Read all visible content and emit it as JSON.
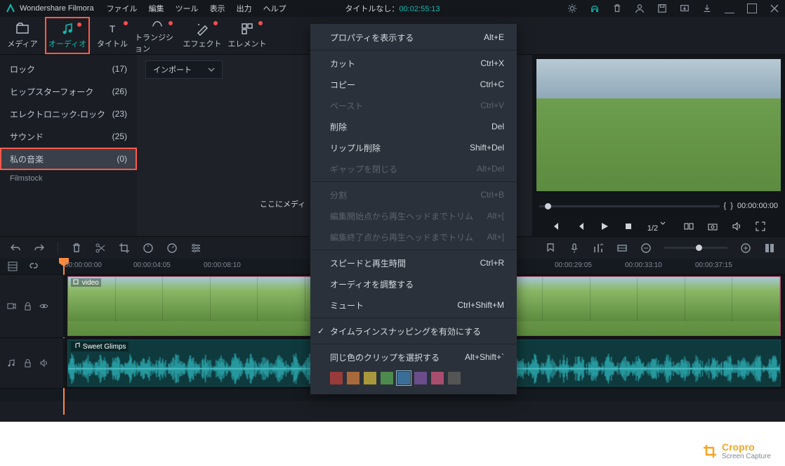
{
  "title_app": "Wondershare Filmora",
  "menus": [
    "ファイル",
    "編集",
    "ツール",
    "表示",
    "出力",
    "ヘルプ"
  ],
  "titlebar_center_pre": "タイトルなし：",
  "titlebar_center_tc": "00:02:55:13",
  "ribbon": [
    {
      "id": "media",
      "label": "メディア"
    },
    {
      "id": "audio",
      "label": "オーディオ"
    },
    {
      "id": "title",
      "label": "タイトル"
    },
    {
      "id": "transition",
      "label": "トランジション"
    },
    {
      "id": "effect",
      "label": "エフェクト"
    },
    {
      "id": "element",
      "label": "エレメント"
    }
  ],
  "side_rows": [
    {
      "label": "ロック",
      "count": "(17)"
    },
    {
      "label": "ヒップスターフォーク",
      "count": "(26)"
    },
    {
      "label": "エレクトロニック-ロック",
      "count": "(23)"
    },
    {
      "label": "サウンド",
      "count": "(25)"
    },
    {
      "label": "私の音楽",
      "count": "(0)"
    }
  ],
  "filmstock": "Filmstock",
  "import_label": "インポート",
  "drop_hint": "ここにメディ",
  "slider_marks": {
    "left": "{",
    "right": "}",
    "time": "00:00:00:00"
  },
  "playback_ratio": "1/2",
  "ruler_ticks": [
    "00:00:00:00",
    "00:00:04:05",
    "00:00:08:10",
    "00:00:29:05",
    "00:00:33:10",
    "00:00:37:15"
  ],
  "track_video_label": "video",
  "track_audio_label": "Sweet Glimps",
  "ctx": {
    "items": [
      {
        "label": "プロパティを表示する",
        "sc": "Alt+E"
      },
      {
        "sep": true
      },
      {
        "label": "カット",
        "sc": "Ctrl+X"
      },
      {
        "label": "コピー",
        "sc": "Ctrl+C"
      },
      {
        "label": "ペースト",
        "sc": "Ctrl+V",
        "dis": true
      },
      {
        "label": "削除",
        "sc": "Del"
      },
      {
        "label": "リップル削除",
        "sc": "Shift+Del"
      },
      {
        "label": "ギャップを閉じる",
        "sc": "Alt+Del",
        "dis": true
      },
      {
        "sep": true
      },
      {
        "label": "分割",
        "sc": "Ctrl+B",
        "dis": true
      },
      {
        "label": "編集開始点から再生ヘッドまでトリム",
        "sc": "Alt+[",
        "dis": true
      },
      {
        "label": "編集終了点から再生ヘッドまでトリム",
        "sc": "Alt+]",
        "dis": true
      },
      {
        "sep": true
      },
      {
        "label": "スピードと再生時間",
        "sc": "Ctrl+R"
      },
      {
        "label": "オーディオを調整する",
        "sc": ""
      },
      {
        "label": "ミュート",
        "sc": "Ctrl+Shift+M"
      },
      {
        "sep": true
      },
      {
        "label": "タイムラインスナッピングを有効にする",
        "chk": true
      },
      {
        "sep": true
      },
      {
        "label": "同じ色のクリップを選択する",
        "sc": "Alt+Shift+`"
      }
    ],
    "colors": [
      "#9a3b3b",
      "#a86a3b",
      "#a8983b",
      "#4d8a4d",
      "#3b6f9a",
      "#6a4d8a",
      "#a84d6d",
      "#555"
    ]
  },
  "watermark": {
    "brand": "Cropro",
    "sub": "Screen Capture"
  }
}
